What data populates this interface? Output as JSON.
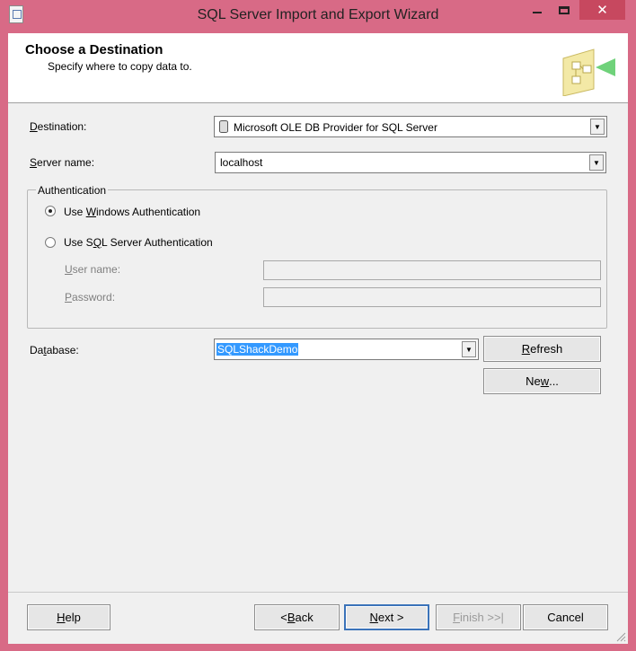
{
  "window": {
    "title": "SQL Server Import and Export Wizard",
    "close_glyph": "✕"
  },
  "header": {
    "title": "Choose a Destination",
    "subtitle": "Specify where to copy data to."
  },
  "form": {
    "destination": {
      "label_pre": "",
      "label_key": "D",
      "label_post": "estination:",
      "value": "Microsoft OLE DB Provider for SQL Server",
      "icon": "database-icon"
    },
    "server_name": {
      "label_pre": "",
      "label_key": "S",
      "label_post": "erver name:",
      "value": "localhost"
    },
    "authentication": {
      "group_label": "Authentication",
      "windows": {
        "label_pre": "Use ",
        "label_key": "W",
        "label_post": "indows Authentication",
        "selected": true
      },
      "sql": {
        "label_pre": "Use S",
        "label_key": "Q",
        "label_post": "L Server Authentication",
        "selected": false
      },
      "user_name": {
        "label_pre": "",
        "label_key": "U",
        "label_post": "ser name:",
        "value": ""
      },
      "password": {
        "label_pre": "",
        "label_key": "P",
        "label_post": "assword:",
        "value": ""
      }
    },
    "database": {
      "label_pre": "Da",
      "label_key": "t",
      "label_post": "abase:",
      "value": "SQLShackDemo"
    },
    "refresh": {
      "label_pre": "",
      "label_key": "R",
      "label_post": "efresh"
    },
    "new": {
      "label_pre": "Ne",
      "label_key": "w",
      "label_post": "..."
    }
  },
  "footer": {
    "help": {
      "label_pre": "",
      "label_key": "H",
      "label_post": "elp"
    },
    "back": {
      "label_pre": "< ",
      "label_key": "B",
      "label_post": "ack"
    },
    "next": {
      "label_pre": "",
      "label_key": "N",
      "label_post": "ext >"
    },
    "finish": {
      "label_pre": "",
      "label_key": "F",
      "label_post": "inish >>|"
    },
    "cancel": {
      "label": "Cancel"
    }
  },
  "colors": {
    "frame": "#d86a86",
    "close_button": "#c7485f",
    "selection": "#3399ff",
    "default_button_border": "#3b73b9"
  }
}
